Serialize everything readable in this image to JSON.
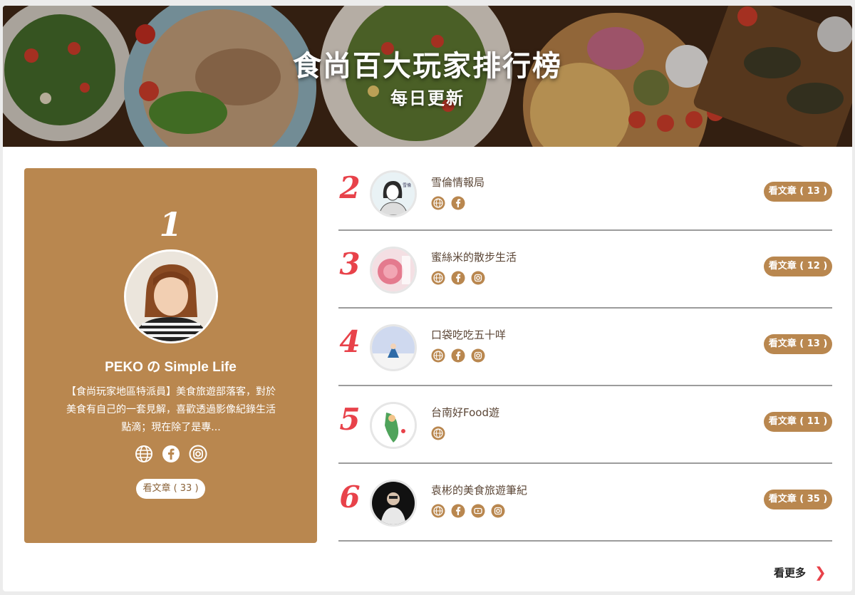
{
  "banner": {
    "title": "食尚百大玩家排行榜",
    "subtitle": "每日更新"
  },
  "featured": {
    "rank": "1",
    "name": "PEKO の Simple Life",
    "description": "【食尚玩家地區特派員】美食旅遊部落客，對於美食有自己的一套見解，喜歡透過影像紀錄生活點滴；現在除了是專...",
    "icons": [
      "globe-icon",
      "facebook-icon",
      "instagram-icon"
    ],
    "button_label": "看文章 ( 33 )"
  },
  "ranking": [
    {
      "rank": "2",
      "name": "雪倫情報局",
      "icons": [
        "globe-icon",
        "facebook-icon"
      ],
      "button_label": "看文章 ( 13 )"
    },
    {
      "rank": "3",
      "name": "蜜絲米的散步生活",
      "icons": [
        "globe-icon",
        "facebook-icon",
        "instagram-icon"
      ],
      "button_label": "看文章 ( 12 )"
    },
    {
      "rank": "4",
      "name": "口袋吃吃五十咩",
      "icons": [
        "globe-icon",
        "facebook-icon",
        "instagram-icon"
      ],
      "button_label": "看文章 ( 13 )"
    },
    {
      "rank": "5",
      "name": "台南好Food遊",
      "icons": [
        "globe-icon"
      ],
      "button_label": "看文章 ( 11 )"
    },
    {
      "rank": "6",
      "name": "袁彬的美食旅遊筆紀",
      "icons": [
        "globe-icon",
        "facebook-icon",
        "youtube-icon",
        "instagram-icon"
      ],
      "button_label": "看文章 ( 35 )"
    }
  ],
  "more_link": "看更多",
  "colors": {
    "accent": "#b9874f",
    "rank_red": "#e8424a",
    "divider": "#9c9c9c"
  }
}
